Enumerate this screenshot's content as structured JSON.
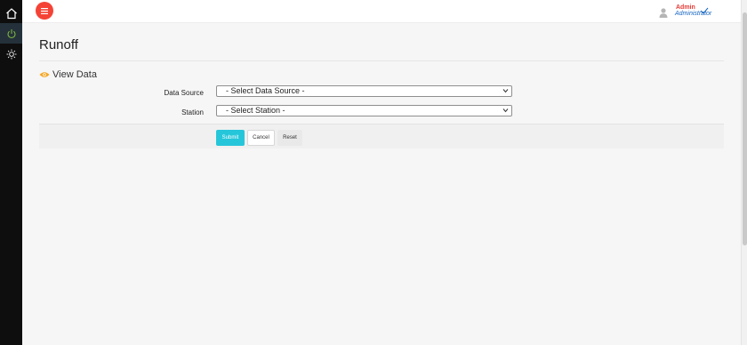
{
  "header": {
    "user_name": "Admin",
    "user_role": "Administrator"
  },
  "sidebar": {
    "items": [
      {
        "icon": "home-icon"
      },
      {
        "icon": "power-icon"
      },
      {
        "icon": "sun-icon"
      }
    ]
  },
  "page": {
    "title": "Runoff",
    "section_title": "View Data"
  },
  "form": {
    "data_source_label": "Data Source",
    "data_source_value": "- Select Data Source -",
    "station_label": "Station",
    "station_value": "- Select Station -"
  },
  "actions": {
    "submit_label": "Submit",
    "cancel_label": "Cancel",
    "reset_label": "Reset"
  },
  "colors": {
    "menu_button": "#f44336",
    "submit_button": "#26c6da",
    "section_icon": "#f5a623",
    "power_icon": "#7cb342"
  }
}
